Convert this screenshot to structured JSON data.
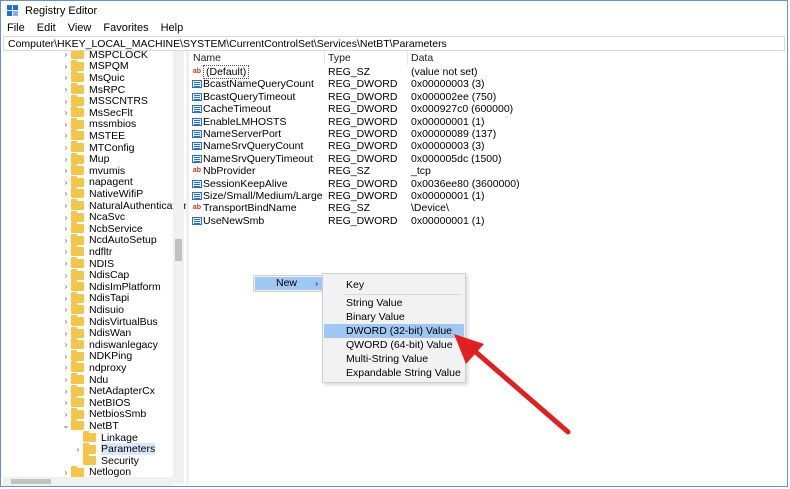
{
  "window": {
    "title": "Registry Editor"
  },
  "menu": [
    "File",
    "Edit",
    "View",
    "Favorites",
    "Help"
  ],
  "address": "Computer\\HKEY_LOCAL_MACHINE\\SYSTEM\\CurrentControlSet\\Services\\NetBT\\Parameters",
  "tree": [
    {
      "label": "MSPCLOCK",
      "chev": "›"
    },
    {
      "label": "MSPQM",
      "chev": "›"
    },
    {
      "label": "MsQuic",
      "chev": "›"
    },
    {
      "label": "MsRPC",
      "chev": "›"
    },
    {
      "label": "MSSCNTRS",
      "chev": "›"
    },
    {
      "label": "MsSecFlt",
      "chev": "›"
    },
    {
      "label": "mssmbios",
      "chev": "›"
    },
    {
      "label": "MSTEE",
      "chev": "›"
    },
    {
      "label": "MTConfig",
      "chev": "›"
    },
    {
      "label": "Mup",
      "chev": "›"
    },
    {
      "label": "mvumis",
      "chev": "›"
    },
    {
      "label": "napagent",
      "chev": "›"
    },
    {
      "label": "NativeWifiP",
      "chev": "›"
    },
    {
      "label": "NaturalAuthentication",
      "chev": "›"
    },
    {
      "label": "NcaSvc",
      "chev": "›"
    },
    {
      "label": "NcbService",
      "chev": "›"
    },
    {
      "label": "NcdAutoSetup",
      "chev": "›"
    },
    {
      "label": "ndfltr",
      "chev": "›"
    },
    {
      "label": "NDIS",
      "chev": "›"
    },
    {
      "label": "NdisCap",
      "chev": "›"
    },
    {
      "label": "NdisImPlatform",
      "chev": "›"
    },
    {
      "label": "NdisTapi",
      "chev": "›"
    },
    {
      "label": "Ndisuio",
      "chev": "›"
    },
    {
      "label": "NdisVirtualBus",
      "chev": "›"
    },
    {
      "label": "NdisWan",
      "chev": "›"
    },
    {
      "label": "ndiswanlegacy",
      "chev": "›"
    },
    {
      "label": "NDKPing",
      "chev": "›"
    },
    {
      "label": "ndproxy",
      "chev": "›"
    },
    {
      "label": "Ndu",
      "chev": "›"
    },
    {
      "label": "NetAdapterCx",
      "chev": "›"
    },
    {
      "label": "NetBIOS",
      "chev": "›"
    },
    {
      "label": "NetbiosSmb",
      "chev": "›"
    },
    {
      "label": "NetBT",
      "chev": "⌄"
    },
    {
      "label": "Linkage",
      "chev": "",
      "indent": 1
    },
    {
      "label": "Parameters",
      "chev": "›",
      "indent": 1,
      "selected": true
    },
    {
      "label": "Security",
      "chev": "",
      "indent": 1
    },
    {
      "label": "Netlogon",
      "chev": "›"
    }
  ],
  "columns": {
    "name": "Name",
    "type": "Type",
    "data": "Data"
  },
  "values": [
    {
      "name": "(Default)",
      "type": "REG_SZ",
      "data": "(value not set)",
      "icon": "ab"
    },
    {
      "name": "BcastNameQueryCount",
      "type": "REG_DWORD",
      "data": "0x00000003 (3)",
      "icon": "bin"
    },
    {
      "name": "BcastQueryTimeout",
      "type": "REG_DWORD",
      "data": "0x000002ee (750)",
      "icon": "bin"
    },
    {
      "name": "CacheTimeout",
      "type": "REG_DWORD",
      "data": "0x000927c0 (600000)",
      "icon": "bin"
    },
    {
      "name": "EnableLMHOSTS",
      "type": "REG_DWORD",
      "data": "0x00000001 (1)",
      "icon": "bin"
    },
    {
      "name": "NameServerPort",
      "type": "REG_DWORD",
      "data": "0x00000089 (137)",
      "icon": "bin"
    },
    {
      "name": "NameSrvQueryCount",
      "type": "REG_DWORD",
      "data": "0x00000003 (3)",
      "icon": "bin"
    },
    {
      "name": "NameSrvQueryTimeout",
      "type": "REG_DWORD",
      "data": "0x000005dc (1500)",
      "icon": "bin"
    },
    {
      "name": "NbProvider",
      "type": "REG_SZ",
      "data": "_tcp",
      "icon": "ab"
    },
    {
      "name": "SessionKeepAlive",
      "type": "REG_DWORD",
      "data": "0x0036ee80 (3600000)",
      "icon": "bin"
    },
    {
      "name": "Size/Small/Medium/Large",
      "type": "REG_DWORD",
      "data": "0x00000001 (1)",
      "icon": "bin"
    },
    {
      "name": "TransportBindName",
      "type": "REG_SZ",
      "data": "\\Device\\",
      "icon": "ab"
    },
    {
      "name": "UseNewSmb",
      "type": "REG_DWORD",
      "data": "0x00000001 (1)",
      "icon": "bin"
    }
  ],
  "context_menu": {
    "label": "New",
    "arrow": "›"
  },
  "submenu": [
    {
      "label": "Key"
    },
    {
      "label": "String Value"
    },
    {
      "label": "Binary Value"
    },
    {
      "label": "DWORD (32-bit) Value",
      "highlighted": true
    },
    {
      "label": "QWORD (64-bit) Value"
    },
    {
      "label": "Multi-String Value"
    },
    {
      "label": "Expandable String Value"
    }
  ],
  "colors": {
    "accent": "#9fc7f2",
    "folder": "#f3c54a",
    "arrow": "#e02020",
    "frame": "#6a8fd0"
  }
}
